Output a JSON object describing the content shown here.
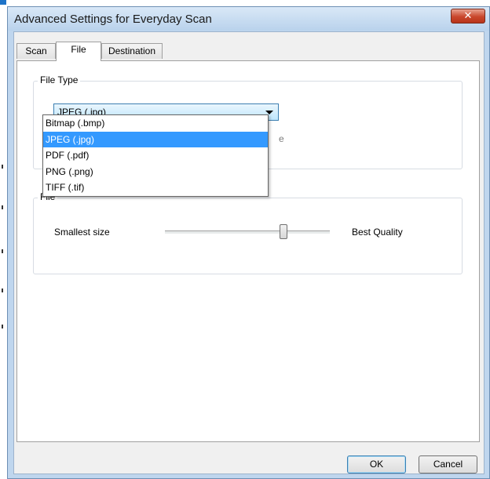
{
  "window": {
    "title": "Advanced Settings for Everyday Scan",
    "close_glyph": "✕"
  },
  "tabs": [
    {
      "label": "Scan",
      "active": false
    },
    {
      "label": "File",
      "active": true
    },
    {
      "label": "Destination",
      "active": false
    }
  ],
  "file_type": {
    "group_label": "File Type",
    "selected": "JPEG (.jpg)",
    "options": [
      "Bitmap (.bmp)",
      "JPEG (.jpg)",
      "PDF (.pdf)",
      "PNG (.png)",
      "TIFF (.tif)"
    ],
    "highlighted_index": 1,
    "partially_hidden_char": "e"
  },
  "file_size": {
    "group_label_visible": "File",
    "min_label": "Smallest size",
    "max_label": "Best Quality",
    "slider_level": 0.72
  },
  "buttons": {
    "ok": "OK",
    "cancel": "Cancel"
  },
  "colors": {
    "selection": "#3399ff",
    "close_button": "#c9472c",
    "window_frame": "#bfd6ee"
  }
}
